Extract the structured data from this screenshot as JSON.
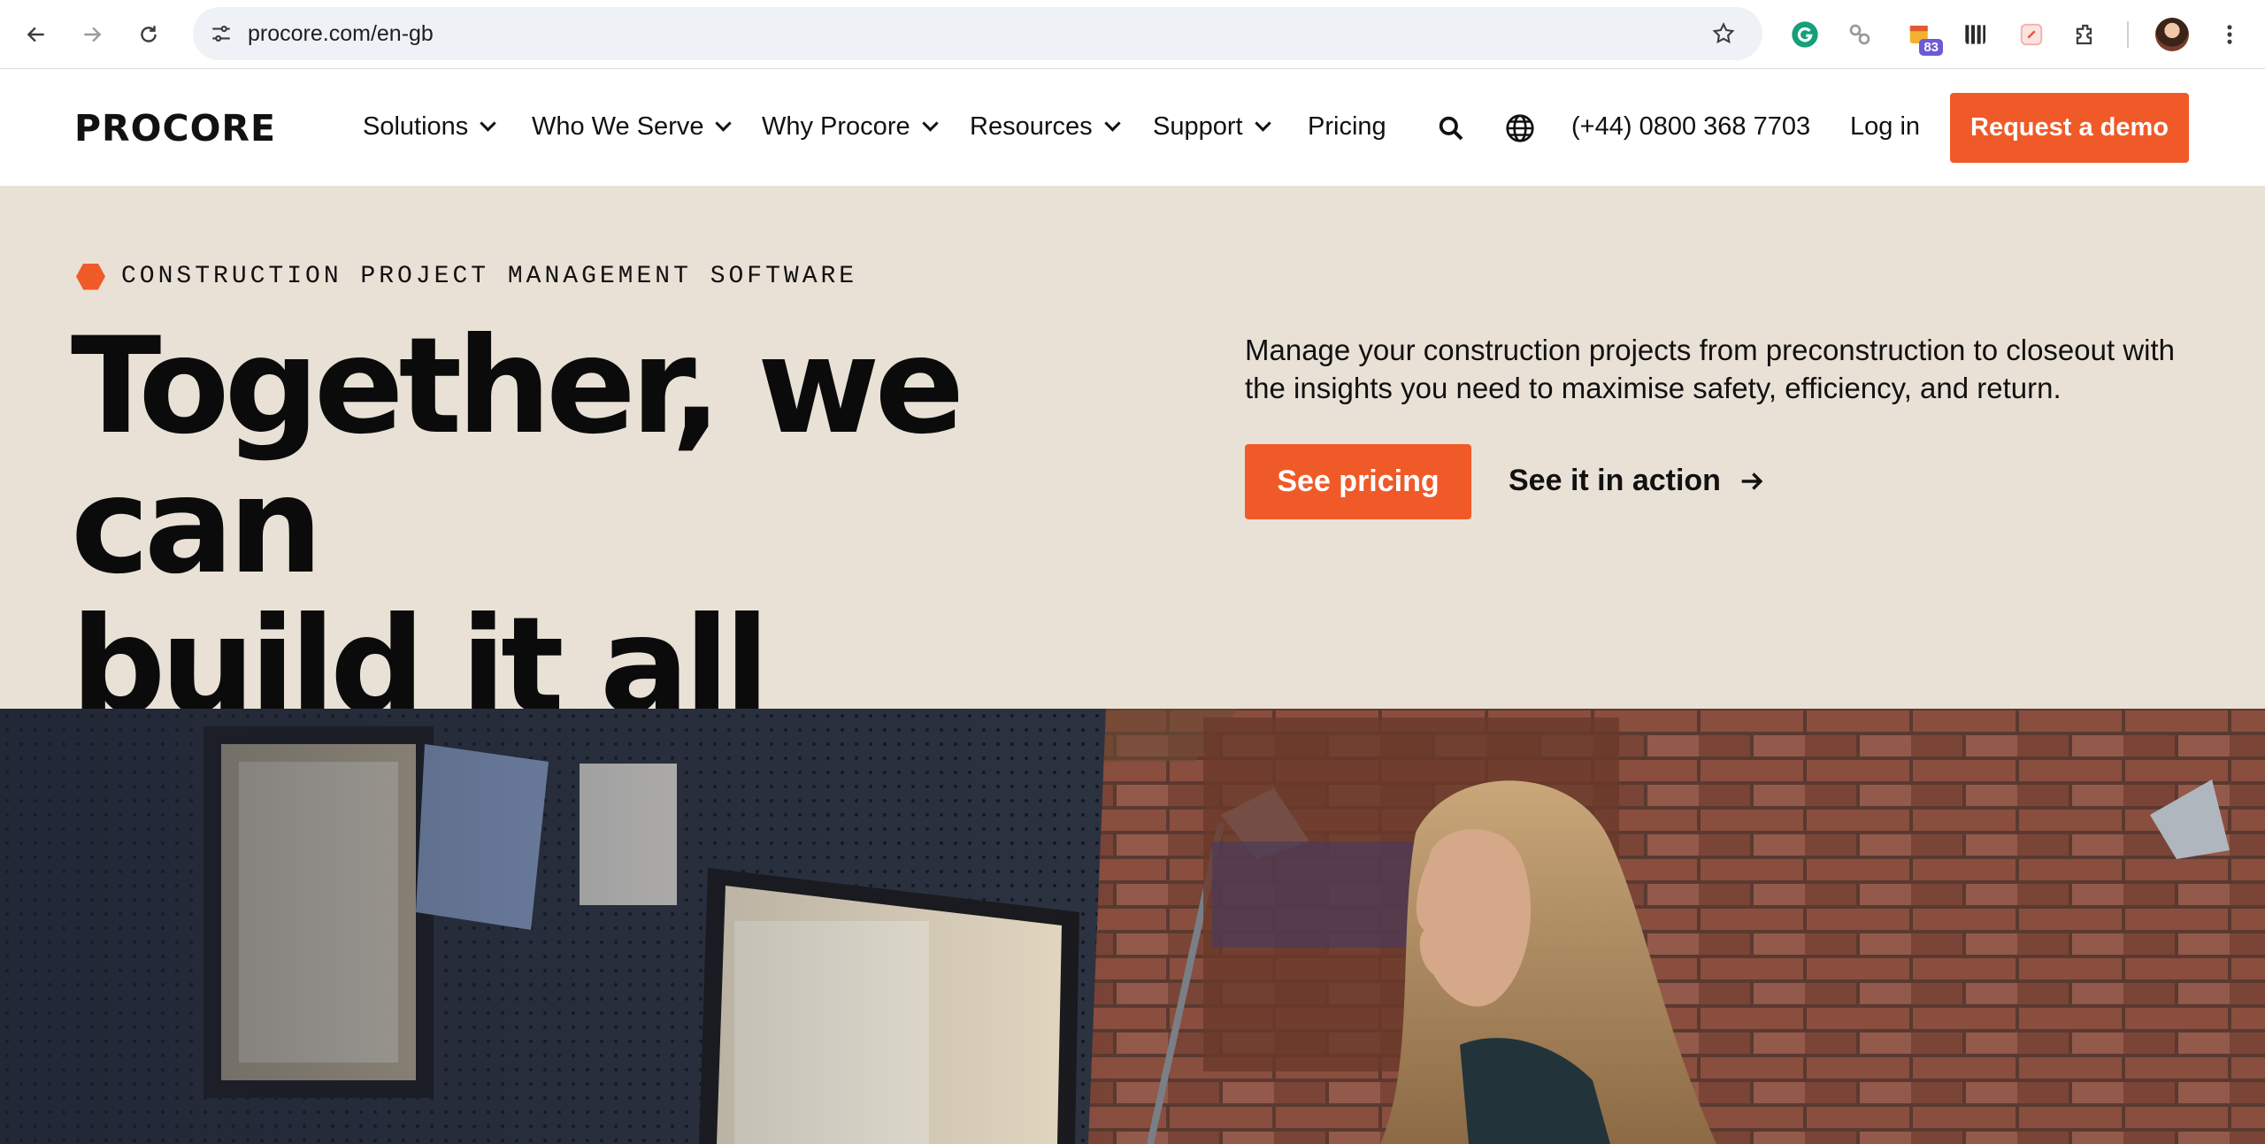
{
  "browser": {
    "url": "procore.com/en-gb",
    "extensions": [
      {
        "icon": "grammarly-icon"
      },
      {
        "icon": "link-extension-icon"
      },
      {
        "icon": "calendar-extension-icon",
        "badge": "83"
      },
      {
        "icon": "toolbox-extension-icon"
      },
      {
        "icon": "tag-extension-icon"
      },
      {
        "icon": "puzzle-extension-icon"
      }
    ]
  },
  "nav": {
    "logo": "PROCORE",
    "items": [
      {
        "label": "Solutions",
        "dropdown": true
      },
      {
        "label": "Who We Serve",
        "dropdown": true
      },
      {
        "label": "Why Procore",
        "dropdown": true
      },
      {
        "label": "Resources",
        "dropdown": true
      },
      {
        "label": "Support",
        "dropdown": true
      },
      {
        "label": "Pricing",
        "dropdown": false
      }
    ],
    "phone": "(+44) 0800 368 7703",
    "login": "Log in",
    "cta": "Request a demo"
  },
  "hero": {
    "eyebrow": "CONSTRUCTION PROJECT MANAGEMENT SOFTWARE",
    "headline_line1": "Together, we can",
    "headline_line2": "build it all",
    "description": "Manage your construction projects from preconstruction to closeout with the insights you need to maximise safety, efficiency, and return.",
    "primary_button": "See pricing",
    "secondary_link": "See it in action"
  },
  "colors": {
    "brand_orange": "#f05a28",
    "hero_background": "#e9e1d6"
  }
}
